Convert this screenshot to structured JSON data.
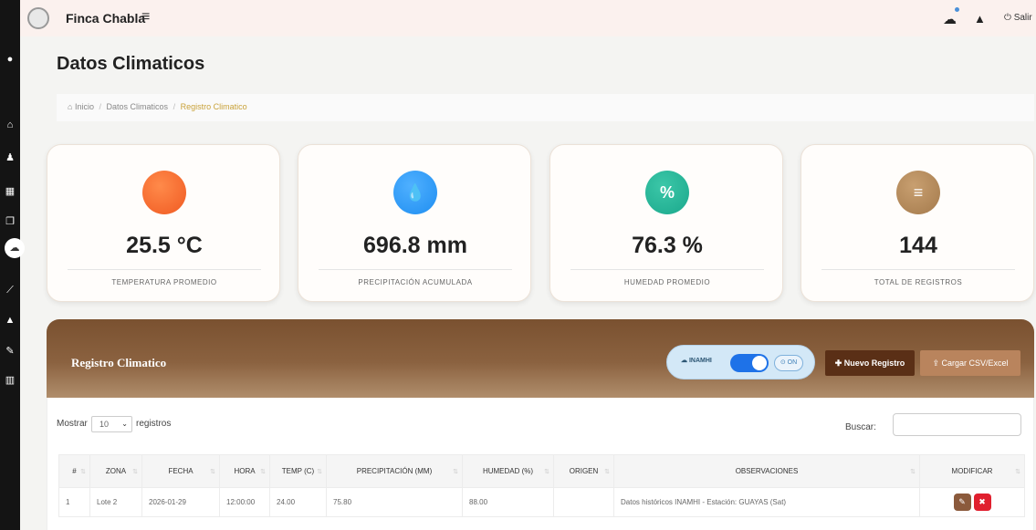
{
  "topbar": {
    "brand": "Finca Chabla",
    "logout": "⏻ Salir"
  },
  "page": {
    "title": "Datos Climaticos"
  },
  "breadcrumb": {
    "home": "Inicio",
    "section": "Datos Climaticos",
    "current": "Registro Climatico"
  },
  "cards": [
    {
      "value": "25.5 °C",
      "label": "TEMPERATURA PROMEDIO",
      "icon": "thermometer-icon",
      "color": "#f05a22"
    },
    {
      "value": "696.8 mm",
      "label": "PRECIPITACIÓN ACUMULADA",
      "icon": "drop-icon",
      "color": "#1f8ef1"
    },
    {
      "value": "76.3 %",
      "label": "HUMEDAD PROMEDIO",
      "icon": "percent-icon",
      "color": "#1aa88c"
    },
    {
      "value": "144",
      "label": "TOTAL DE REGISTROS",
      "icon": "database-icon",
      "color": "#a47a4c"
    }
  ],
  "panel": {
    "title": "Registro Climatico",
    "inamhi_label": "INAMHI",
    "toggle_on": true,
    "on_badge": "ON",
    "btn_nuevo": "Nuevo Registro",
    "btn_csv": "Cargar CSV/Excel"
  },
  "table_controls": {
    "show_label": "Mostrar",
    "page_size": "10",
    "records_label": "registros",
    "search_label": "Buscar:"
  },
  "table": {
    "headers": [
      "#",
      "ZONA",
      "FECHA",
      "HORA",
      "TEMP (C)",
      "PRECIPITACIÓN (MM)",
      "HUMEDAD (%)",
      "ORIGEN",
      "OBSERVACIONES",
      "MODIFICAR"
    ],
    "rows": [
      [
        "1",
        "Lote 2",
        "2026-01-29",
        "12:00:00",
        "24.00",
        "75.80",
        "88.00",
        "",
        "Datos históricos INAMHI - Estación: GUAYAS (Sat)"
      ]
    ]
  },
  "colors": {
    "sidebar": "#141414",
    "panel_brown": "#7a5130",
    "btn_nuevo": "#5a2f16",
    "btn_csv": "#b9845d",
    "delete": "#e01f2e"
  }
}
